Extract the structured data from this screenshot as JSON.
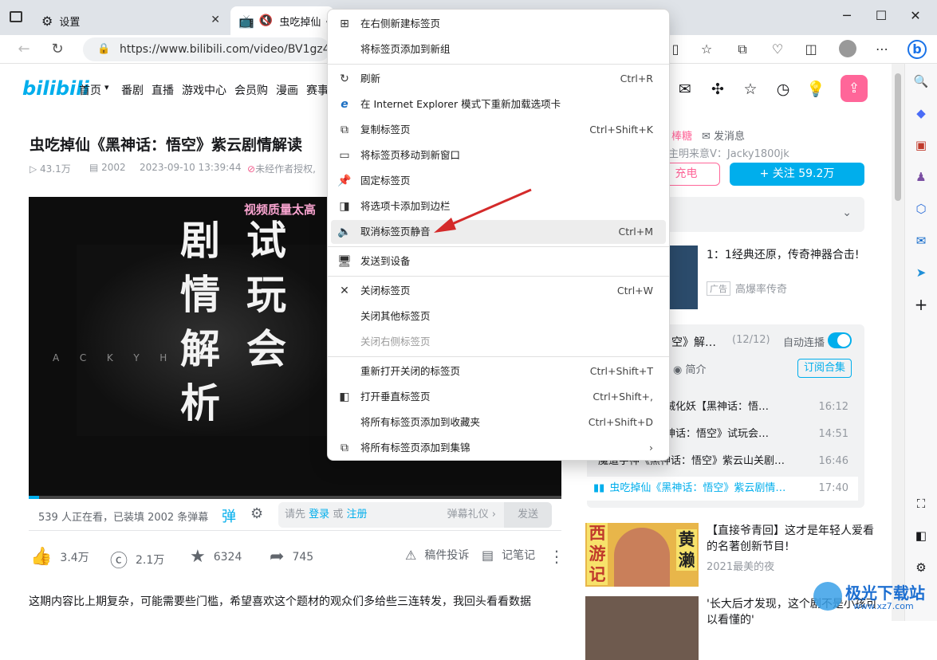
{
  "browser": {
    "tabs": [
      {
        "label": "设置",
        "icon": "gear-icon"
      },
      {
        "label": "虫吃掉仙《",
        "icon": "bilibili-tab-icon",
        "muted": true
      }
    ],
    "url": "https://www.bilibili.com/video/BV1gz4y1j7"
  },
  "bili": {
    "logo": "bilibili",
    "nav": [
      "首页",
      "番剧",
      "直播",
      "游戏中心",
      "会员购",
      "漫画",
      "赛事"
    ],
    "video_title": "虫吃掉仙《黑神话：悟空》紫云剧情解读",
    "views": "43.1万",
    "danmaku_count": "2002",
    "date": "2023-09-10 13:39:44",
    "no_repost": "未经作者授权,",
    "player_overlay": "视频质量太高",
    "player_cal_col1": [
      "剧",
      "情",
      "解",
      "析"
    ],
    "player_cal_col2": [
      "试",
      "玩",
      "会"
    ],
    "player_watermark": "A  C  K  Y  H",
    "watching": "539 人正在看，已装填 2002 条弹幕",
    "dm_placeholder_prefix": "请先",
    "dm_login": "登录",
    "dm_or": "或",
    "dm_register": "注册",
    "dm_gift": "弹幕礼仪 ›",
    "dm_send": "发送",
    "likes": "3.4万",
    "coins": "2.1万",
    "favs": "6324",
    "shares": "745",
    "report": "稿件投诉",
    "notes": "记笔记",
    "description": "这期内容比上期复杂，可能需要些门槛，希望喜欢这个题材的观众们多给些三连转发，我回头看看数据",
    "up_tag": "棒糖",
    "send_msg": "发消息",
    "up_sign": "主明来意V：Jacky1800jk",
    "charge": "充电",
    "follow": "+ 关注 59.2万",
    "ad_title": "1：1经典还原，传奇神器合击!",
    "ad_tag": "广告",
    "ad_source": "高爆率传奇",
    "playlist_title": "空》解…",
    "playlist_count": "(12/12)",
    "autoplay": "自动连播",
    "intro": "简介",
    "subscribe": "订阅合集",
    "playlist": [
      {
        "title": "六根贼化妖【黑神话：悟…",
        "dur": "16:12"
      },
      {
        "title": "《黑神话：悟空》试玩会…",
        "dur": "14:51"
      },
      {
        "title": "魔道字神《黑神话：悟空》紫云山关剧…",
        "dur": "16:46"
      },
      {
        "title": "虫吃掉仙《黑神话：悟空》紫云剧情…",
        "dur": "17:40"
      }
    ],
    "rec1_title": "【直接爷青回】这才是年轻人爱看的名著创新节目!",
    "rec1_sub": "2021最美的夜",
    "rec1_thumb_left": "西游记",
    "rec1_thumb_right": "黄濑",
    "rec2_title": "'长大后才发现，这个剧不是小孩可以看懂的'",
    "watermark_text": "极光下载站",
    "watermark_url": "www.xz7.com"
  },
  "context_menu": {
    "items": [
      {
        "label": "在右侧新建标签页",
        "shortcut": "",
        "icon": "new-tab-icon"
      },
      {
        "label": "将标签页添加到新组",
        "shortcut": "",
        "icon": ""
      },
      {
        "label": "刷新",
        "shortcut": "Ctrl+R",
        "icon": "refresh-icon"
      },
      {
        "label": "在 Internet Explorer 模式下重新加载选项卡",
        "shortcut": "",
        "icon": "ie-icon"
      },
      {
        "label": "复制标签页",
        "shortcut": "Ctrl+Shift+K",
        "icon": "duplicate-icon"
      },
      {
        "label": "将标签页移动到新窗口",
        "shortcut": "",
        "icon": "window-icon"
      },
      {
        "label": "固定标签页",
        "shortcut": "",
        "icon": "pin-icon"
      },
      {
        "label": "将选项卡添加到边栏",
        "shortcut": "",
        "icon": "sidebar-add-icon"
      },
      {
        "label": "取消标签页静音",
        "shortcut": "Ctrl+M",
        "icon": "speaker-icon"
      },
      {
        "label": "发送到设备",
        "shortcut": "",
        "icon": "send-device-icon"
      },
      {
        "label": "关闭标签页",
        "shortcut": "Ctrl+W",
        "icon": "close-icon"
      },
      {
        "label": "关闭其他标签页",
        "shortcut": "",
        "icon": ""
      },
      {
        "label": "关闭右侧标签页",
        "shortcut": "",
        "icon": ""
      },
      {
        "label": "重新打开关闭的标签页",
        "shortcut": "Ctrl+Shift+T",
        "icon": ""
      },
      {
        "label": "打开垂直标签页",
        "shortcut": "Ctrl+Shift+,",
        "icon": "vertical-tabs-icon"
      },
      {
        "label": "将所有标签页添加到收藏夹",
        "shortcut": "Ctrl+Shift+D",
        "icon": ""
      },
      {
        "label": "将所有标签页添加到集锦",
        "shortcut": "›",
        "icon": "collections-icon"
      }
    ]
  }
}
